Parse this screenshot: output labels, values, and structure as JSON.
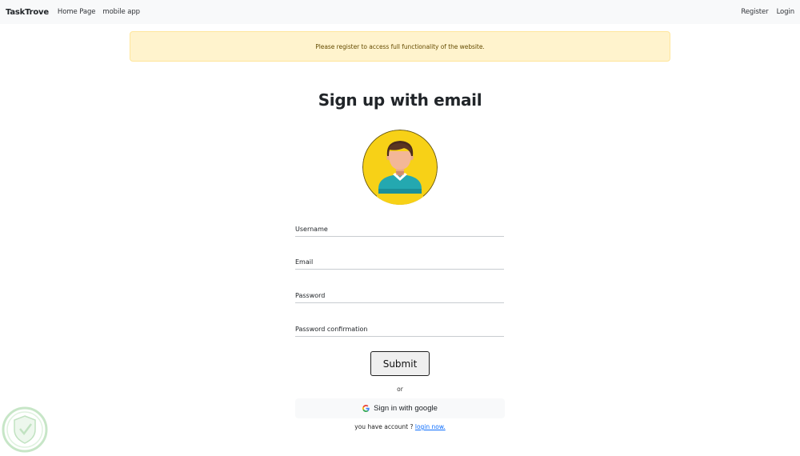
{
  "navbar": {
    "brand": "TaskTrove",
    "links": [
      {
        "label": "Home Page"
      },
      {
        "label": "mobile app"
      }
    ],
    "right_links": [
      {
        "label": "Register"
      },
      {
        "label": "Login"
      }
    ]
  },
  "alert": {
    "message": "Please register to access full functionality of the website."
  },
  "form": {
    "title": "Sign up with email",
    "avatar_icon": "user-avatar-icon",
    "fields": {
      "username": {
        "placeholder": "Username",
        "value": ""
      },
      "email": {
        "placeholder": "Email",
        "value": ""
      },
      "password": {
        "placeholder": "Password",
        "value": ""
      },
      "password_confirmation": {
        "placeholder": "Password confirmation",
        "value": ""
      }
    },
    "submit_label": "Submit",
    "or_label": "or",
    "google_icon": "google-g-icon",
    "google_label": "Sign in with google",
    "account_prompt": "you have account ?",
    "login_link": "login now."
  },
  "colors": {
    "navbar_bg": "#f8f9fa",
    "alert_bg": "#fff3cd",
    "alert_border": "#ffe69c",
    "alert_text": "#664d03",
    "avatar_bg": "#f7d117",
    "link": "#0d6efd"
  }
}
